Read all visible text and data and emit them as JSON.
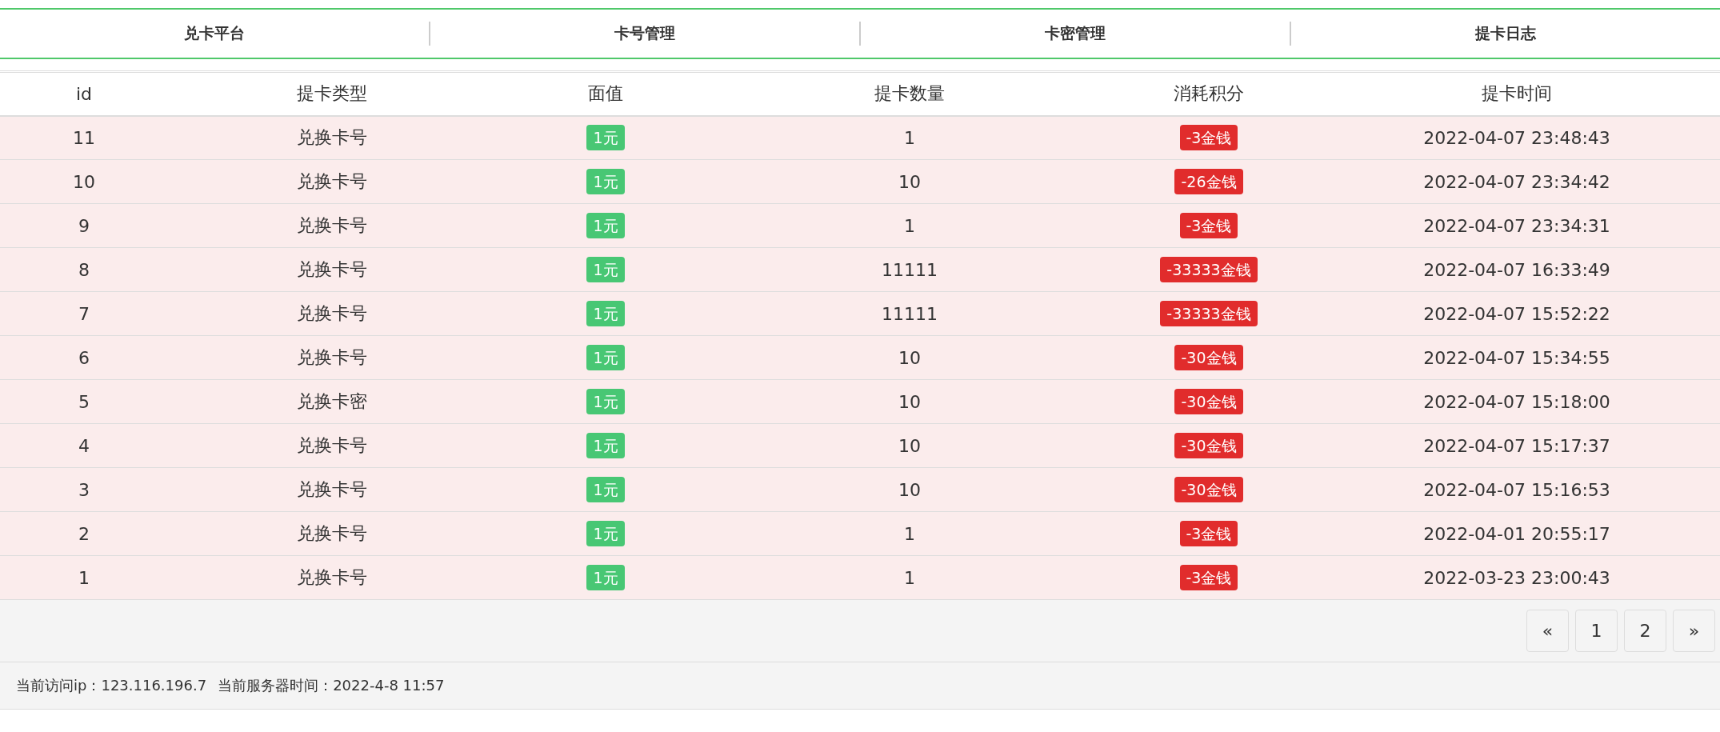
{
  "nav": {
    "items": [
      {
        "label": "兑卡平台"
      },
      {
        "label": "卡号管理"
      },
      {
        "label": "卡密管理"
      },
      {
        "label": "提卡日志"
      }
    ]
  },
  "table": {
    "columns": [
      "id",
      "提卡类型",
      "面值",
      "提卡数量",
      "消耗积分",
      "提卡时间"
    ],
    "rows": [
      {
        "id": "11",
        "type": "兑换卡号",
        "value": "1元",
        "count": "1",
        "cost": "-3金钱",
        "time": "2022-04-07 23:48:43"
      },
      {
        "id": "10",
        "type": "兑换卡号",
        "value": "1元",
        "count": "10",
        "cost": "-26金钱",
        "time": "2022-04-07 23:34:42"
      },
      {
        "id": "9",
        "type": "兑换卡号",
        "value": "1元",
        "count": "1",
        "cost": "-3金钱",
        "time": "2022-04-07 23:34:31"
      },
      {
        "id": "8",
        "type": "兑换卡号",
        "value": "1元",
        "count": "11111",
        "cost": "-33333金钱",
        "time": "2022-04-07 16:33:49"
      },
      {
        "id": "7",
        "type": "兑换卡号",
        "value": "1元",
        "count": "11111",
        "cost": "-33333金钱",
        "time": "2022-04-07 15:52:22"
      },
      {
        "id": "6",
        "type": "兑换卡号",
        "value": "1元",
        "count": "10",
        "cost": "-30金钱",
        "time": "2022-04-07 15:34:55"
      },
      {
        "id": "5",
        "type": "兑换卡密",
        "value": "1元",
        "count": "10",
        "cost": "-30金钱",
        "time": "2022-04-07 15:18:00"
      },
      {
        "id": "4",
        "type": "兑换卡号",
        "value": "1元",
        "count": "10",
        "cost": "-30金钱",
        "time": "2022-04-07 15:17:37"
      },
      {
        "id": "3",
        "type": "兑换卡号",
        "value": "1元",
        "count": "10",
        "cost": "-30金钱",
        "time": "2022-04-07 15:16:53"
      },
      {
        "id": "2",
        "type": "兑换卡号",
        "value": "1元",
        "count": "1",
        "cost": "-3金钱",
        "time": "2022-04-01 20:55:17"
      },
      {
        "id": "1",
        "type": "兑换卡号",
        "value": "1元",
        "count": "1",
        "cost": "-3金钱",
        "time": "2022-03-23 23:00:43"
      }
    ]
  },
  "pagination": [
    "«",
    "1",
    "2",
    "»"
  ],
  "footer": {
    "ip": "当前访问ip：123.116.196.7",
    "server_time": "当前服务器时间：2022-4-8 11:57"
  }
}
